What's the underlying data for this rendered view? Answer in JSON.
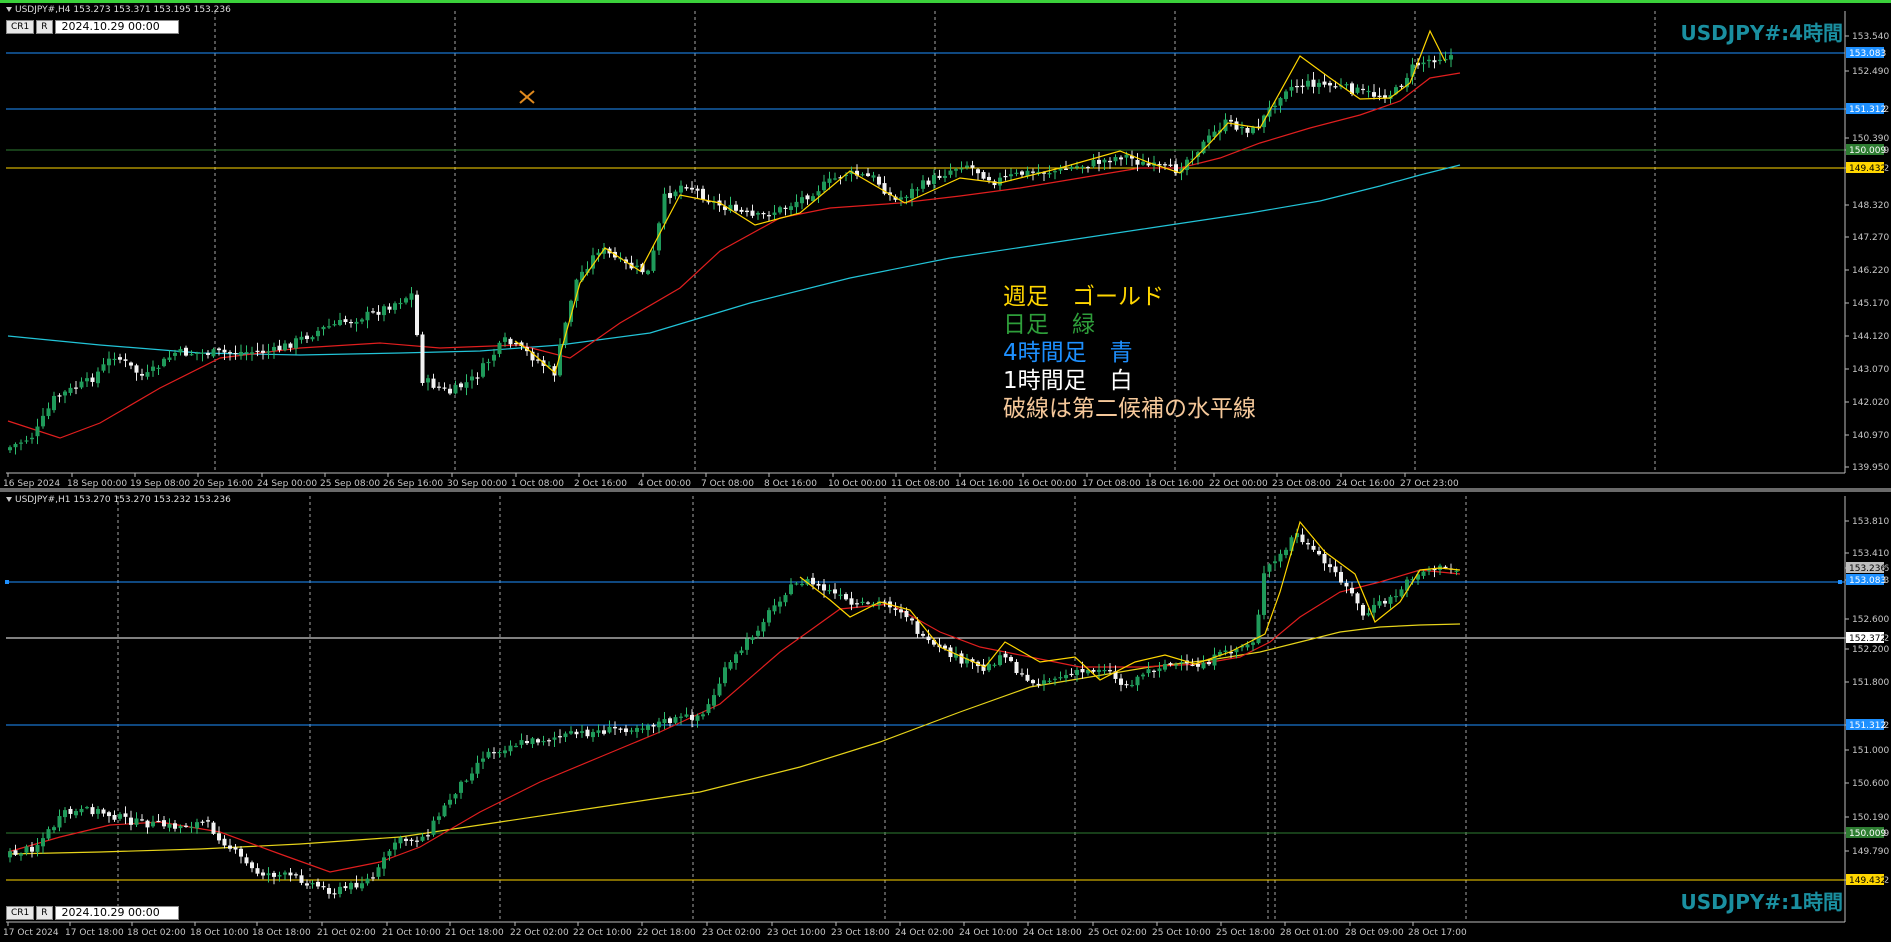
{
  "panel_top": {
    "header": "USDJPY#,H4  153.273 153.371 153.195 153.236",
    "toolbar": {
      "btn1": "CR1",
      "btn2": "R",
      "date": "2024.10.29 00:00"
    },
    "symbol_title": "USDJPY#:4時間",
    "y_ticks": [
      "153.540",
      "152.490",
      "151.312",
      "150.390",
      "150.009",
      "149.432",
      "148.320",
      "147.270",
      "146.220",
      "145.170",
      "144.120",
      "143.070",
      "142.020",
      "140.970",
      "139.950"
    ],
    "price_labels": [
      {
        "text": "153.083",
        "color": "#1e90ff"
      },
      {
        "text": "151.312",
        "color": "#1e90ff"
      },
      {
        "text": "150.009",
        "color": "#2e7d32"
      },
      {
        "text": "149.432",
        "color": "#ffd600"
      }
    ],
    "x_ticks": [
      "16 Sep 2024",
      "18 Sep 00:00",
      "19 Sep 08:00",
      "20 Sep 16:00",
      "24 Sep 00:00",
      "25 Sep 08:00",
      "26 Sep 16:00",
      "30 Sep 00:00",
      "1 Oct 08:00",
      "2 Oct 16:00",
      "4 Oct 00:00",
      "7 Oct 08:00",
      "8 Oct 16:00",
      "10 Oct 00:00",
      "11 Oct 08:00",
      "14 Oct 16:00",
      "16 Oct 00:00",
      "17 Oct 08:00",
      "18 Oct 16:00",
      "22 Oct 00:00",
      "23 Oct 08:00",
      "24 Oct 16:00",
      "27 Oct 23:00"
    ],
    "legend": [
      {
        "text": "週足　ゴールド",
        "color": "#ffd600"
      },
      {
        "text": "日足　緑",
        "color": "#2e9e3a"
      },
      {
        "text": "4時間足　青",
        "color": "#1e90ff"
      },
      {
        "text": "1時間足　白",
        "color": "#ffffff"
      },
      {
        "text": "破線は第二候補の水平線",
        "color": "#f5c89a"
      }
    ]
  },
  "panel_bottom": {
    "header": "USDJPY#,H1  153.270 153.270 153.232 153.236",
    "toolbar": {
      "btn1": "CR1",
      "btn2": "R",
      "date": "2024.10.29 00:00"
    },
    "symbol_title": "USDJPY#:1時間",
    "y_ticks": [
      "153.810",
      "153.410",
      "153.236",
      "153.083",
      "152.600",
      "152.372",
      "152.200",
      "151.800",
      "151.312",
      "151.000",
      "150.600",
      "150.190",
      "150.009",
      "149.790",
      "149.432"
    ],
    "price_labels": [
      {
        "text": "153.236",
        "color": "#bdbdbd"
      },
      {
        "text": "153.083",
        "color": "#1e90ff"
      },
      {
        "text": "152.372",
        "color": "#ffffff"
      },
      {
        "text": "151.312",
        "color": "#1e90ff"
      },
      {
        "text": "150.009",
        "color": "#2e7d32"
      },
      {
        "text": "149.432",
        "color": "#ffd600"
      }
    ],
    "x_ticks": [
      "17 Oct 2024",
      "17 Oct 18:00",
      "18 Oct 02:00",
      "18 Oct 10:00",
      "18 Oct 18:00",
      "21 Oct 02:00",
      "21 Oct 10:00",
      "21 Oct 18:00",
      "22 Oct 02:00",
      "22 Oct 10:00",
      "22 Oct 18:00",
      "23 Oct 02:00",
      "23 Oct 10:00",
      "23 Oct 18:00",
      "24 Oct 02:00",
      "24 Oct 10:00",
      "24 Oct 18:00",
      "25 Oct 02:00",
      "25 Oct 10:00",
      "25 Oct 18:00",
      "28 Oct 01:00",
      "28 Oct 09:00",
      "28 Oct 17:00"
    ]
  }
}
